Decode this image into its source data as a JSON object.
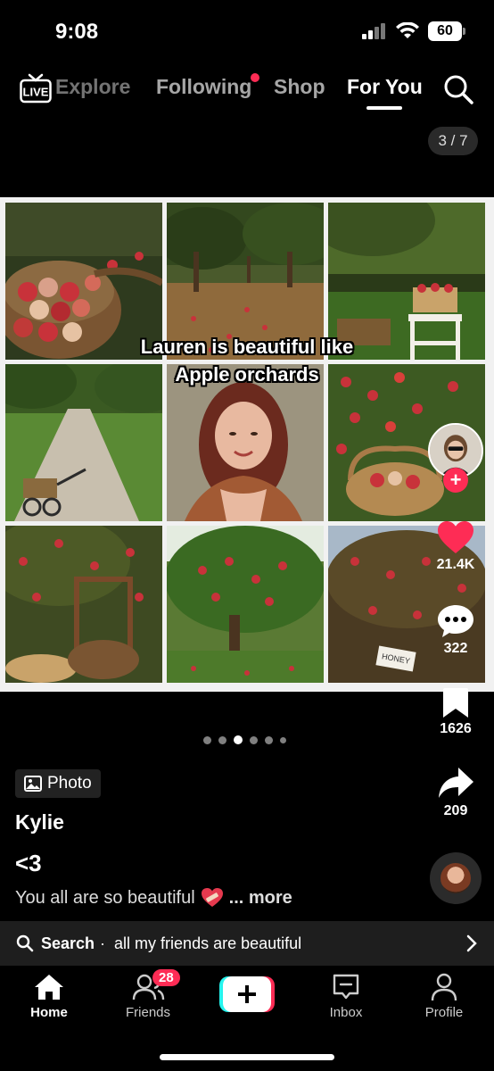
{
  "status_bar": {
    "time": "9:08",
    "battery": "60"
  },
  "top_nav": {
    "live_label": "LIVE",
    "tabs": [
      "Explore",
      "Following",
      "Shop",
      "For You"
    ],
    "active_tab": "For You",
    "search_icon": "search-icon"
  },
  "post": {
    "image_counter": "3 / 7",
    "caption_line1": "Lauren is beautiful  like",
    "caption_line2": "Apple orchards",
    "type_tag": "Photo",
    "username": "Kylie",
    "title": "<3",
    "description": "You all are so beautiful",
    "more_label": "... more",
    "total_images": 7,
    "current_image": 3
  },
  "actions": {
    "likes": "21.4K",
    "comments": "322",
    "saves": "1626",
    "shares": "209"
  },
  "search_suggestion": {
    "label": "Search",
    "separator": "·",
    "query": "all my friends are beautiful"
  },
  "bottom_nav": {
    "items": [
      {
        "label": "Home",
        "icon": "home-icon"
      },
      {
        "label": "Friends",
        "icon": "friends-icon",
        "badge": "28"
      },
      {
        "label": "",
        "icon": "create-icon"
      },
      {
        "label": "Inbox",
        "icon": "inbox-icon"
      },
      {
        "label": "Profile",
        "icon": "profile-icon"
      }
    ]
  },
  "colors": {
    "accent": "#fe2c55",
    "background": "#000000"
  }
}
